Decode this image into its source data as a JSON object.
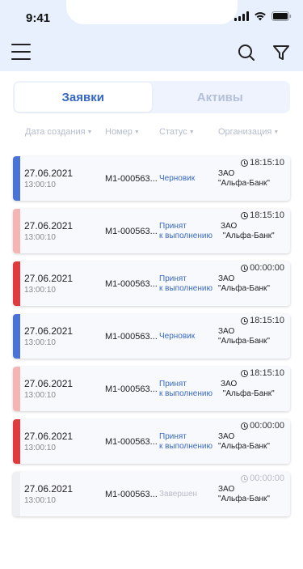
{
  "status_bar": {
    "time": "9:41"
  },
  "nav": {
    "menu_icon": "menu-icon",
    "search_icon": "search-icon",
    "filter_icon": "filter-icon"
  },
  "tabs": [
    {
      "label": "Заявки",
      "active": true
    },
    {
      "label": "Активы",
      "active": false
    }
  ],
  "columns": [
    {
      "label": "Дата создания"
    },
    {
      "label": "Номер"
    },
    {
      "label": "Статус"
    },
    {
      "label": "Организация"
    }
  ],
  "colors": {
    "accent": "#3567c7",
    "draft": "#4a73d6",
    "accepted": "#f5b5b5",
    "urgent": "#e0393e",
    "done": "#eef0f4"
  },
  "rows": [
    {
      "date": "27.06.2021",
      "time": "13:00:10",
      "number": "М1-000563...",
      "status": "Черновик",
      "org": "ЗАО\n\"Альфа-Банк\"",
      "timer": "18:15:10",
      "bar_color": "#4a73d6"
    },
    {
      "date": "27.06.2021",
      "time": "13:00:10",
      "number": "М1-000563...",
      "status": "Принят\nк выполнению",
      "org": "ЗАО\n \"Альфа-Банк\"",
      "timer": "18:15:10",
      "bar_color": "#f5b5b5"
    },
    {
      "date": "27.06.2021",
      "time": "13:00:10",
      "number": "М1-000563...",
      "status": "Принят\nк выполнению",
      "org": "ЗАО\n\"Альфа-Банк\"",
      "timer": "00:00:00",
      "bar_color": "#e0393e"
    },
    {
      "date": "27.06.2021",
      "time": "13:00:10",
      "number": "М1-000563...",
      "status": "Черновик",
      "org": "ЗАО\n\"Альфа-Банк\"",
      "timer": "18:15:10",
      "bar_color": "#4a73d6"
    },
    {
      "date": "27.06.2021",
      "time": "13:00:10",
      "number": "М1-000563...",
      "status": "Принят\nк выполнению",
      "org": "ЗАО\n \"Альфа-Банк\"",
      "timer": "18:15:10",
      "bar_color": "#f5b5b5"
    },
    {
      "date": "27.06.2021",
      "time": "13:00:10",
      "number": "М1-000563...",
      "status": "Принят\nк выполнению",
      "org": "ЗАО\n\"Альфа-Банк\"",
      "timer": "00:00:00",
      "bar_color": "#e0393e"
    },
    {
      "date": "27.06.2021",
      "time": "13:00:10",
      "number": "М1-000563...",
      "status": "Завершен",
      "org": "ЗАО\n\"Альфа-Банк\"",
      "timer": "00:00:00",
      "bar_color": "#eef0f4"
    }
  ]
}
